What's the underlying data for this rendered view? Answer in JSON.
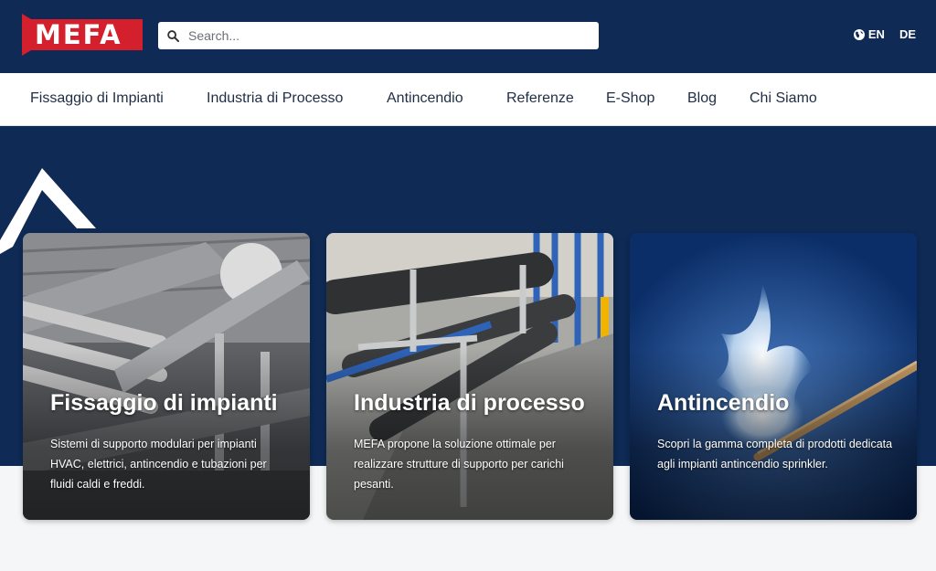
{
  "header": {
    "logo_text": "MEFA",
    "search": {
      "placeholder": "Search..."
    },
    "languages": [
      "EN",
      "DE"
    ]
  },
  "nav": {
    "items": [
      "Fissaggio di Impianti",
      "Industria di Processo",
      "Antincendio",
      "Referenze",
      "E-Shop",
      "Blog",
      "Chi Siamo"
    ]
  },
  "cards": [
    {
      "title": "Fissaggio di impianti",
      "description": "Sistemi di supporto modulari per impianti HVAC, elettrici, antincendio e tubazioni per fluidi caldi e freddi."
    },
    {
      "title": "Industria di processo",
      "description": "MEFA propone la soluzione ottimale per realizzare strutture di supporto per carichi pesanti."
    },
    {
      "title": "Antincendio",
      "description": "Scopri la gamma completa di prodotti dedicata agli impianti antincendio sprinkler."
    }
  ],
  "colors": {
    "brand_navy": "#0e2a55",
    "brand_red": "#d4202c"
  }
}
